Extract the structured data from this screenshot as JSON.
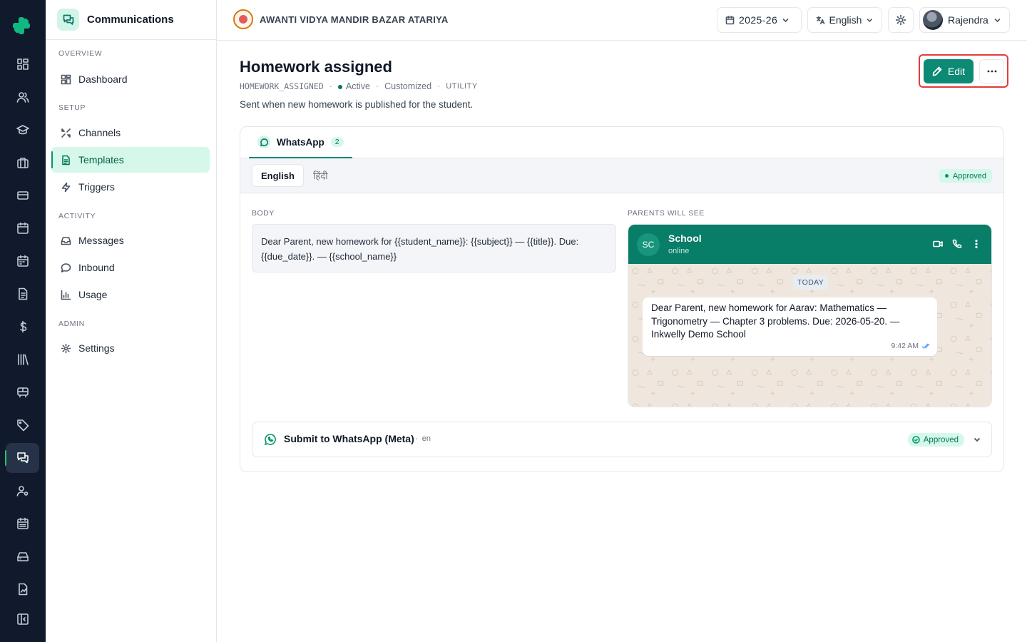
{
  "sidebar": {
    "title": "Communications",
    "sections": {
      "overview": "OVERVIEW",
      "setup": "SETUP",
      "activity": "ACTIVITY",
      "admin": "ADMIN"
    },
    "items": {
      "dashboard": "Dashboard",
      "channels": "Channels",
      "templates": "Templates",
      "triggers": "Triggers",
      "messages": "Messages",
      "inbound": "Inbound",
      "usage": "Usage",
      "settings": "Settings"
    }
  },
  "topbar": {
    "school_name": "AWANTI VIDYA MANDIR BAZAR ATARIYA",
    "academic_year": "2025-26",
    "language": "English",
    "user_name": "Rajendra"
  },
  "template": {
    "title": "Homework assigned",
    "code": "HOMEWORK_ASSIGNED",
    "status": "Active",
    "customization": "Customized",
    "category": "UTILITY",
    "description": "Sent when new homework is published for the student.",
    "edit_label": "Edit"
  },
  "channel_tab": {
    "label": "WhatsApp",
    "count": "2"
  },
  "languages": {
    "english": "English",
    "hindi": "हिंदी",
    "approval_status": "Approved"
  },
  "body": {
    "label": "BODY",
    "text": "Dear Parent, new homework for {{student_name}}: {{subject}} — {{title}}. Due: {{due_date}}. — {{school_name}}"
  },
  "preview": {
    "label": "PARENTS WILL SEE",
    "avatar_initials": "SC",
    "contact_name": "School",
    "contact_status": "online",
    "day_label": "TODAY",
    "message": "Dear Parent, new homework for Aarav: Mathematics — Trigonometry — Chapter 3 problems. Due: 2026-05-20. — Inkwelly Demo School",
    "time": "9:42 AM"
  },
  "submission": {
    "title": "Submit to WhatsApp (Meta)",
    "language_code": "en",
    "status": "Approved"
  },
  "colors": {
    "primary": "#0d8a74",
    "rail_bg": "#111a2c",
    "whatsapp_header": "#087d67",
    "approved_bg": "#d5f8ea",
    "approved_text": "#047857",
    "highlight": "#e23c3c"
  }
}
